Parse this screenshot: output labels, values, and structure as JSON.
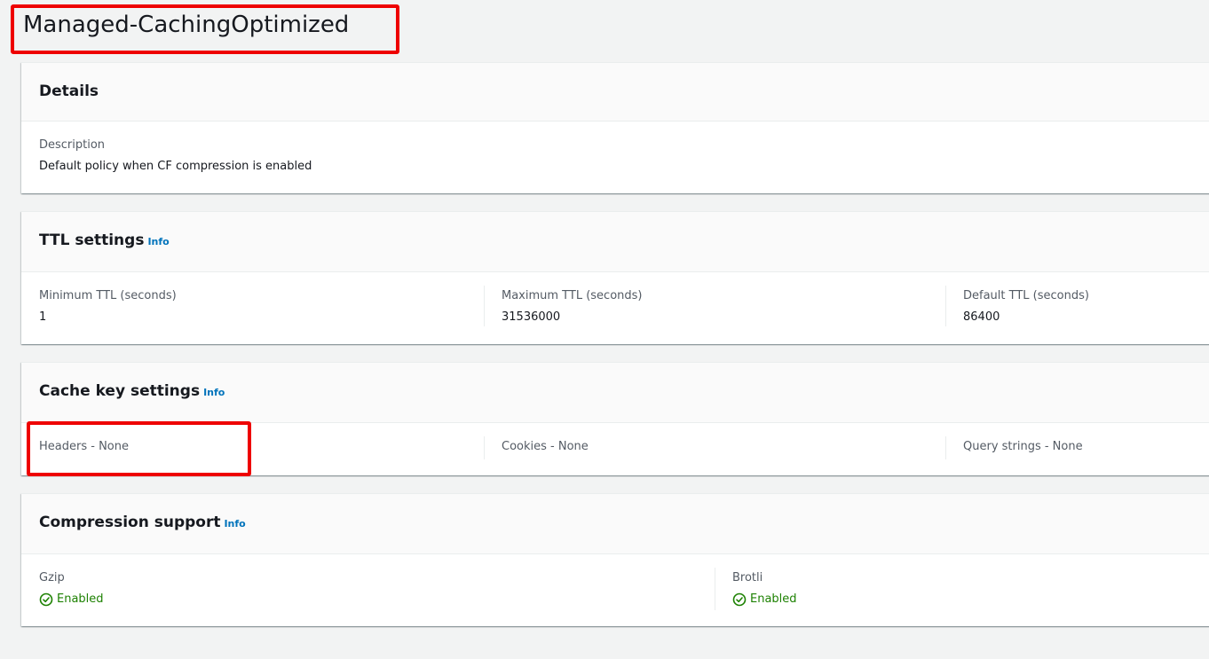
{
  "page": {
    "title": "Managed-CachingOptimized"
  },
  "details": {
    "title": "Details",
    "description_label": "Description",
    "description_value": "Default policy when CF compression is enabled"
  },
  "ttl": {
    "title": "TTL settings",
    "info": "Info",
    "min_label": "Minimum TTL (seconds)",
    "min_value": "1",
    "max_label": "Maximum TTL (seconds)",
    "max_value": "31536000",
    "default_label": "Default TTL (seconds)",
    "default_value": "86400"
  },
  "cache_key": {
    "title": "Cache key settings",
    "info": "Info",
    "headers": "Headers - None",
    "cookies": "Cookies - None",
    "query_strings": "Query strings - None"
  },
  "compression": {
    "title": "Compression support",
    "info": "Info",
    "gzip_label": "Gzip",
    "gzip_status": "Enabled",
    "brotli_label": "Brotli",
    "brotli_status": "Enabled",
    "status_icon": "check-circle-icon",
    "status_color": "#1d8102"
  },
  "annotations": {
    "highlight_color": "#ee0000"
  }
}
